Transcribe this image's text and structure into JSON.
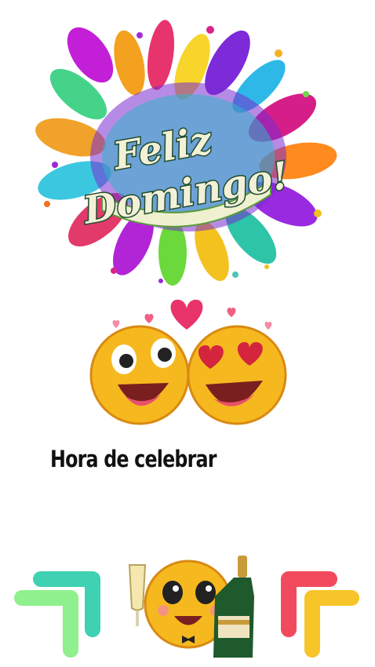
{
  "logo": {
    "line1": "Feliz",
    "line2": "Domingo!"
  },
  "caption": "Hora de celebrar",
  "icons": {
    "splash": "paint-splash-graphic",
    "kissing": "kissing-emoji-couple-icon",
    "hearts": "heart-icon",
    "champagne": "champagne-toast-emoji-icon",
    "arrow_left": "corner-arrow-left-icon",
    "arrow_right": "corner-arrow-right-icon"
  },
  "colors": {
    "background": "#ffffff",
    "emoji_yellow": "#f6b81f",
    "heart_pink": "#e8336b",
    "logo_text": "#f3f0d8",
    "arrow_teal": "#3fd1b1",
    "arrow_green": "#8ff08d",
    "arrow_red": "#f24a5d",
    "arrow_yellow": "#f7c429"
  }
}
